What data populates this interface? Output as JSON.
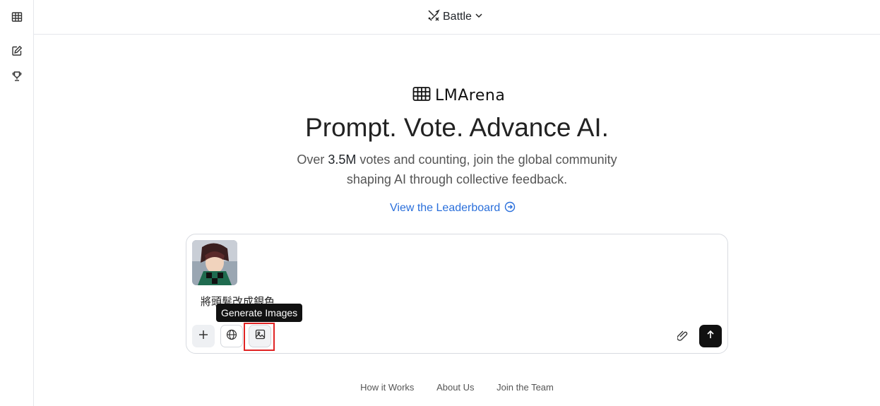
{
  "header": {
    "mode_label": "Battle"
  },
  "sidebar": {
    "items": [
      "leaderboard-grid-icon",
      "new-chat-icon",
      "trophy-icon"
    ]
  },
  "hero": {
    "brand": "LMArena",
    "headline": "Prompt. Vote. Advance AI.",
    "subtitle_pre": "Over ",
    "subtitle_count": "3.5M",
    "subtitle_post": " votes and counting, join the global community",
    "subtitle_line2": "shaping AI through collective feedback.",
    "leaderboard_link": "View the Leaderboard"
  },
  "composer": {
    "prompt_text": "將頭髮改成銀色",
    "tooltip": "Generate Images"
  },
  "footer": {
    "links": [
      "How it Works",
      "About Us",
      "Join the Team"
    ]
  },
  "colors": {
    "accent": "#2a6fdb",
    "highlight": "#e02424",
    "send_button": "#111111"
  }
}
